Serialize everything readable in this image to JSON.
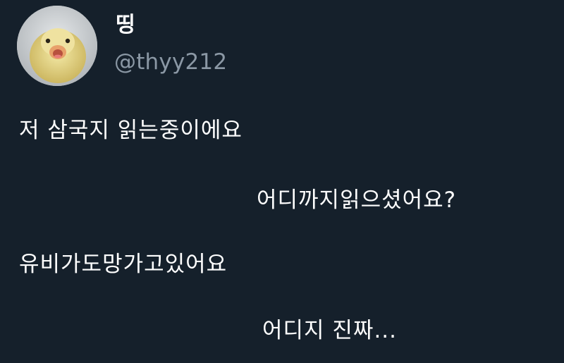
{
  "tweet": {
    "author": {
      "display_name": "띵",
      "handle": "@thyy212",
      "avatar_icon": "duckling-avatar"
    },
    "lines": [
      "저 삼국지 읽는중이에요",
      "어디까지읽으셨어요?",
      "유비가도망가고있어요",
      "어디지 진짜..."
    ]
  },
  "colors": {
    "background": "#15202b",
    "primary_text": "#ffffff",
    "secondary_text": "#8b98a5"
  }
}
